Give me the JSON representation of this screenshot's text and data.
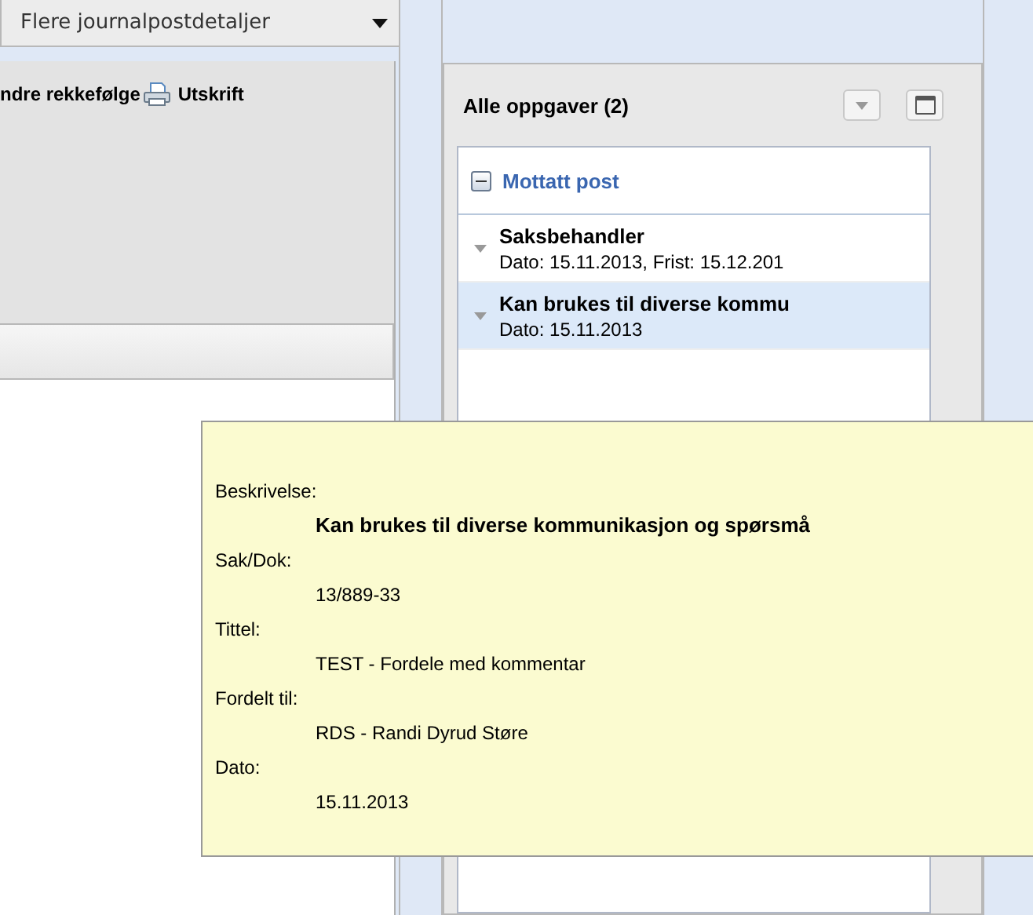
{
  "dropdown": {
    "label": "Flere journalpostdetaljer"
  },
  "toolbar": {
    "items": [
      {
        "kind": "text",
        "label": "ndre rekkefølge"
      },
      {
        "kind": "print",
        "label": "Utskrift"
      }
    ]
  },
  "tasks_panel": {
    "title": "Alle oppgaver (2)",
    "group": {
      "label": "Mottatt post",
      "expanded": true,
      "rows": [
        {
          "title": "Saksbehandler",
          "detail": "Dato: 15.11.2013, Frist: 15.12.201",
          "selected": false
        },
        {
          "title": "Kan brukes til diverse kommu",
          "detail": "Dato: 15.11.2013",
          "selected": true
        }
      ]
    }
  },
  "tooltip": {
    "fields": [
      {
        "label": "Beskrivelse:",
        "value": "Kan brukes til diverse kommunikasjon og spørsmå",
        "bold": true
      },
      {
        "label": "Sak/Dok:",
        "value": "13/889-33",
        "bold": false
      },
      {
        "label": "Tittel:",
        "value": "TEST - Fordele med kommentar",
        "bold": false
      },
      {
        "label": "Fordelt til:",
        "value": "RDS - Randi Dyrud Støre",
        "bold": false
      },
      {
        "label": "Dato:",
        "value": "15.11.2013",
        "bold": false
      }
    ]
  }
}
